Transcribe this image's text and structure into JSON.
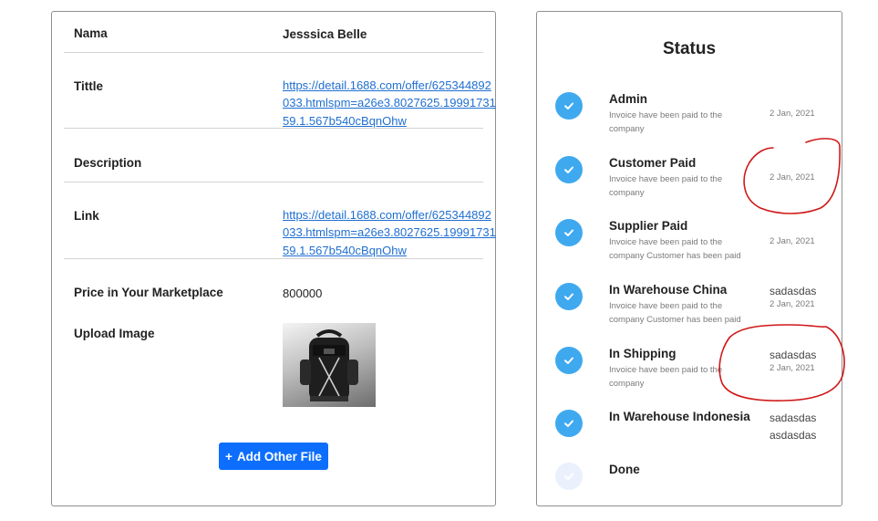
{
  "product": {
    "name_label": "Nama",
    "name_value": "Jesssica Belle",
    "title_label": "Tittle",
    "title_link": "https://detail.1688.com/offer/625344892033.htmlspm=a26e3.8027625.1999173159.1.567b540cBqnOhw",
    "description_label": "Description",
    "description_value": "",
    "link_label": "Link",
    "link_value": "https://detail.1688.com/offer/625344892033.htmlspm=a26e3.8027625.1999173159.1.567b540cBqnOhw",
    "price_label": "Price in Your Marketplace",
    "price_value": "800000",
    "upload_label": "Upload Image",
    "add_button_label": "Add Other File",
    "add_button_icon": "+"
  },
  "status": {
    "title": "Status",
    "accent_color": "#3fa9ef",
    "steps": [
      {
        "name": "Admin",
        "desc": "Invoice have been paid to the company",
        "date": "2 Jan, 2021",
        "done": true
      },
      {
        "name": "Customer Paid",
        "desc": "Invoice have been paid to the company",
        "date": "2 Jan, 2021",
        "done": true
      },
      {
        "name": "Supplier Paid",
        "desc": "Invoice have been paid to the company Customer has been paid",
        "date": "2 Jan, 2021",
        "done": true
      },
      {
        "name": "In Warehouse China",
        "desc": "Invoice have been paid to the company Customer has been paid",
        "note": "sadasdas",
        "date": "2 Jan, 2021",
        "done": true
      },
      {
        "name": "In Shipping",
        "desc": "Invoice have been paid to the company",
        "note": "sadasdas",
        "date": "2 Jan, 2021",
        "done": true
      },
      {
        "name": "In Warehouse Indonesia",
        "note": "sadasdas",
        "note2": "asdasdas",
        "done": true
      },
      {
        "name": "Done",
        "done": false
      }
    ]
  }
}
